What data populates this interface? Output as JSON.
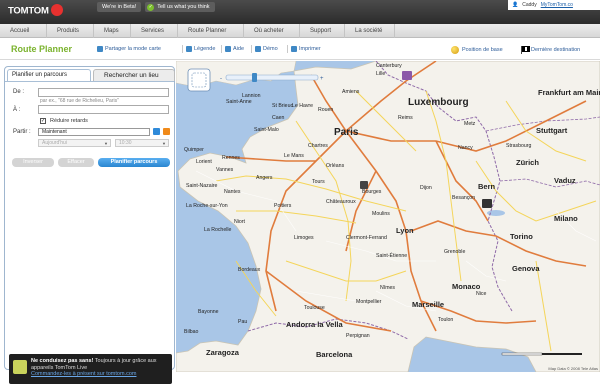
{
  "header": {
    "logo": "TOMTOM",
    "beta": "We're in Beta!",
    "feedback": "Tell us what you think",
    "user": "Caddy",
    "account_link": "MyTomTom.co"
  },
  "nav": [
    "Accueil",
    "Produits",
    "Maps",
    "Services",
    "Route Planner",
    "Où acheter",
    "Support",
    "La société"
  ],
  "toolbar": {
    "title": "Route Planner",
    "share": "Partager la mode carte",
    "legend": "Légende",
    "help": "Aide",
    "demo": "Démo",
    "print": "Imprimer",
    "base": "Position de base",
    "last": "Dernière destination"
  },
  "panel": {
    "tab_plan": "Planifier un parcours",
    "tab_search": "Rechercher un lieu",
    "from_label": "De :",
    "from_placeholder": "",
    "to_label": "À :",
    "to_hint": "par ex., \"68 rue de Richelieu, Paris\"",
    "to_placeholder": "",
    "avoid_delays": "Réduire retards",
    "depart_label": "Partir :",
    "depart_value": "Maintenant",
    "date_value": "Aujourd'hui",
    "time_value": "10:30",
    "btn_reverse": "Inverser",
    "btn_clear": "Effacer",
    "btn_plan": "Planifier parcours",
    "promo_title": "Ne conduisez pas sans!",
    "promo_body": "Toujours à jour grâce aux appareils TomTom Live",
    "promo_link": "Commandez-les à présent sur tomtom.com"
  },
  "map": {
    "labels": {
      "saint_anne": "Saint-Anne",
      "saint_malo": "Saint-Malo",
      "st_brieuc": "St Brieuc",
      "lannion": "Lannion",
      "quimper": "Quimper",
      "lorient": "Lorient",
      "vannes": "Vannes",
      "rennes": "Rennes",
      "nantes": "Nantes",
      "saint_nazaire": "Saint-Nazaire",
      "la_roche": "La Roche-sur-Yon",
      "niort": "Niort",
      "poitiers": "Poitiers",
      "la_rochelle": "La Rochelle",
      "limoges": "Limoges",
      "bordeaux": "Bordeaux",
      "pau": "Pau",
      "bayonne": "Bayonne",
      "angers": "Angers",
      "tours": "Tours",
      "le_mans": "Le Mans",
      "caen": "Caen",
      "le_havre": "Le Havre",
      "rouen": "Rouen",
      "amiens": "Amiens",
      "lille": "Lille",
      "paris": "Paris",
      "orleans": "Orléans",
      "chartres": "Chartres",
      "reims": "Reims",
      "metz": "Metz",
      "nancy": "Nancy",
      "strasbourg": "Strasbourg",
      "dijon": "Dijon",
      "besancon": "Besançon",
      "lyon": "Lyon",
      "grenoble": "Grenoble",
      "clermont": "Clermont-Ferrand",
      "saint_etienne": "Saint-Étienne",
      "toulouse": "Toulouse",
      "montpellier": "Montpellier",
      "nimes": "Nîmes",
      "marseille": "Marseille",
      "toulon": "Toulon",
      "nice": "Nice",
      "monaco": "Monaco",
      "genova": "Genova",
      "torino": "Torino",
      "milano": "Milano",
      "bern": "Bern",
      "zurich": "Zürich",
      "vaduz": "Vaduz",
      "luxembourg": "Luxembourg",
      "frankfurt": "Frankfurt am Main",
      "stuttgart": "Stuttgart",
      "andorra": "Andorra la Vella",
      "zaragoza": "Zaragoza",
      "barcelona": "Barcelona",
      "bilbao": "Bilbao",
      "chateauroux": "Châteauroux",
      "bourges": "Bourges",
      "moulins": "Moulins",
      "perpignan": "Perpignan",
      "canterbury": "Canterbury"
    },
    "copyright": "Map Data © 2008 Tele Atlas",
    "colors": {
      "land": "#f4f2ec",
      "sea": "#a9c6e7",
      "motorway": "#e07c3d",
      "road": "#f4d55a",
      "border": "#8f6aa8"
    }
  }
}
